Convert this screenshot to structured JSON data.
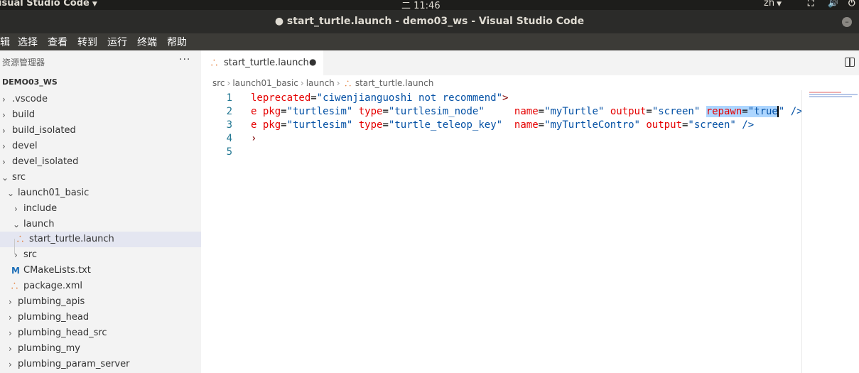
{
  "topbar": {
    "app_name": "isual Studio Code",
    "clock": "二 11:46",
    "lang": "zh",
    "tray": [
      "network-icon",
      "volume-icon",
      "power-icon"
    ]
  },
  "window": {
    "title": "● start_turtle.launch - demo03_ws - Visual Studio Code"
  },
  "menu": [
    "辑",
    "选择",
    "查看",
    "转到",
    "运行",
    "终端",
    "帮助"
  ],
  "sidebar": {
    "header": "资源管理器",
    "more": "···",
    "workspace": "DEMO03_WS",
    "items": [
      {
        "label": ".vscode",
        "type": "folder",
        "state": "collapsed",
        "depth": 0
      },
      {
        "label": "build",
        "type": "folder",
        "state": "collapsed",
        "depth": 0
      },
      {
        "label": "build_isolated",
        "type": "folder",
        "state": "collapsed",
        "depth": 0
      },
      {
        "label": "devel",
        "type": "folder",
        "state": "collapsed",
        "depth": 0
      },
      {
        "label": "devel_isolated",
        "type": "folder",
        "state": "collapsed",
        "depth": 0
      },
      {
        "label": "src",
        "type": "folder",
        "state": "expanded",
        "depth": 0
      },
      {
        "label": "launch01_basic",
        "type": "folder",
        "state": "expanded",
        "depth": 1
      },
      {
        "label": "include",
        "type": "folder",
        "state": "collapsed",
        "depth": 2
      },
      {
        "label": "launch",
        "type": "folder",
        "state": "expanded",
        "depth": 2
      },
      {
        "label": "start_turtle.launch",
        "type": "xml",
        "state": "file",
        "depth": 3,
        "selected": true
      },
      {
        "label": "src",
        "type": "folder",
        "state": "collapsed",
        "depth": 2
      },
      {
        "label": "CMakeLists.txt",
        "type": "cmake",
        "state": "file",
        "depth": 2
      },
      {
        "label": "package.xml",
        "type": "xml",
        "state": "file",
        "depth": 2
      },
      {
        "label": "plumbing_apis",
        "type": "folder",
        "state": "collapsed",
        "depth": 1
      },
      {
        "label": "plumbing_head",
        "type": "folder",
        "state": "collapsed",
        "depth": 1
      },
      {
        "label": "plumbing_head_src",
        "type": "folder",
        "state": "collapsed",
        "depth": 1
      },
      {
        "label": "plumbing_my",
        "type": "folder",
        "state": "collapsed",
        "depth": 1
      },
      {
        "label": "plumbing_param_server",
        "type": "folder",
        "state": "collapsed",
        "depth": 1
      }
    ]
  },
  "editor": {
    "tab": {
      "label": "start_turtle.launch",
      "modified_marker": "●"
    },
    "breadcrumb": [
      "src",
      "launch01_basic",
      "launch",
      "start_turtle.launch"
    ],
    "lines": [
      {
        "number": "1",
        "tokens": [
          {
            "t": "attr",
            "v": "leprecated"
          },
          {
            "t": "plain",
            "v": "="
          },
          {
            "t": "str",
            "v": "\"ciwenjianguoshi not recommend\""
          },
          {
            "t": "tagc",
            "v": ">"
          }
        ]
      },
      {
        "number": "2",
        "tokens": [
          {
            "t": "attr",
            "v": "e "
          },
          {
            "t": "attr",
            "v": "pkg"
          },
          {
            "t": "plain",
            "v": "="
          },
          {
            "t": "str",
            "v": "\"turtlesim\""
          },
          {
            "t": "plain",
            "v": " "
          },
          {
            "t": "attr",
            "v": "type"
          },
          {
            "t": "plain",
            "v": "="
          },
          {
            "t": "str",
            "v": "\"turtlesim_node\""
          },
          {
            "t": "plain",
            "v": "     "
          },
          {
            "t": "attr",
            "v": "name"
          },
          {
            "t": "plain",
            "v": "="
          },
          {
            "t": "str",
            "v": "\"myTurtle\""
          },
          {
            "t": "plain",
            "v": " "
          },
          {
            "t": "attr",
            "v": "output"
          },
          {
            "t": "plain",
            "v": "="
          },
          {
            "t": "str",
            "v": "\"screen\""
          },
          {
            "t": "plain",
            "v": " "
          },
          {
            "t": "attr-sel",
            "v": "repawn"
          },
          {
            "t": "plain-sel",
            "v": "="
          },
          {
            "t": "str-sel",
            "v": "\"true"
          },
          {
            "t": "cursor",
            "v": ""
          },
          {
            "t": "str",
            "v": "\""
          },
          {
            "t": "plain",
            "v": " "
          },
          {
            "t": "str",
            "v": "/>"
          }
        ]
      },
      {
        "number": "3",
        "tokens": [
          {
            "t": "attr",
            "v": "e "
          },
          {
            "t": "attr",
            "v": "pkg"
          },
          {
            "t": "plain",
            "v": "="
          },
          {
            "t": "str",
            "v": "\"turtlesim\""
          },
          {
            "t": "plain",
            "v": " "
          },
          {
            "t": "attr",
            "v": "type"
          },
          {
            "t": "plain",
            "v": "="
          },
          {
            "t": "str",
            "v": "\"turtle_teleop_key\""
          },
          {
            "t": "plain",
            "v": "  "
          },
          {
            "t": "attr",
            "v": "name"
          },
          {
            "t": "plain",
            "v": "="
          },
          {
            "t": "str",
            "v": "\"myTurtleContro\""
          },
          {
            "t": "plain",
            "v": " "
          },
          {
            "t": "attr",
            "v": "output"
          },
          {
            "t": "plain",
            "v": "="
          },
          {
            "t": "str",
            "v": "\"screen\""
          },
          {
            "t": "plain",
            "v": " "
          },
          {
            "t": "str",
            "v": "/>"
          }
        ]
      },
      {
        "number": "4",
        "tokens": [
          {
            "t": "tagc",
            "v": "›"
          }
        ]
      },
      {
        "number": "5",
        "tokens": []
      }
    ]
  },
  "colors": {
    "attribute": "#e50000",
    "string": "#0451a5",
    "selection": "#add6ff",
    "line_number": "#237893",
    "xml_icon": "#e37933",
    "cmake_icon": "#1e6fb8"
  }
}
